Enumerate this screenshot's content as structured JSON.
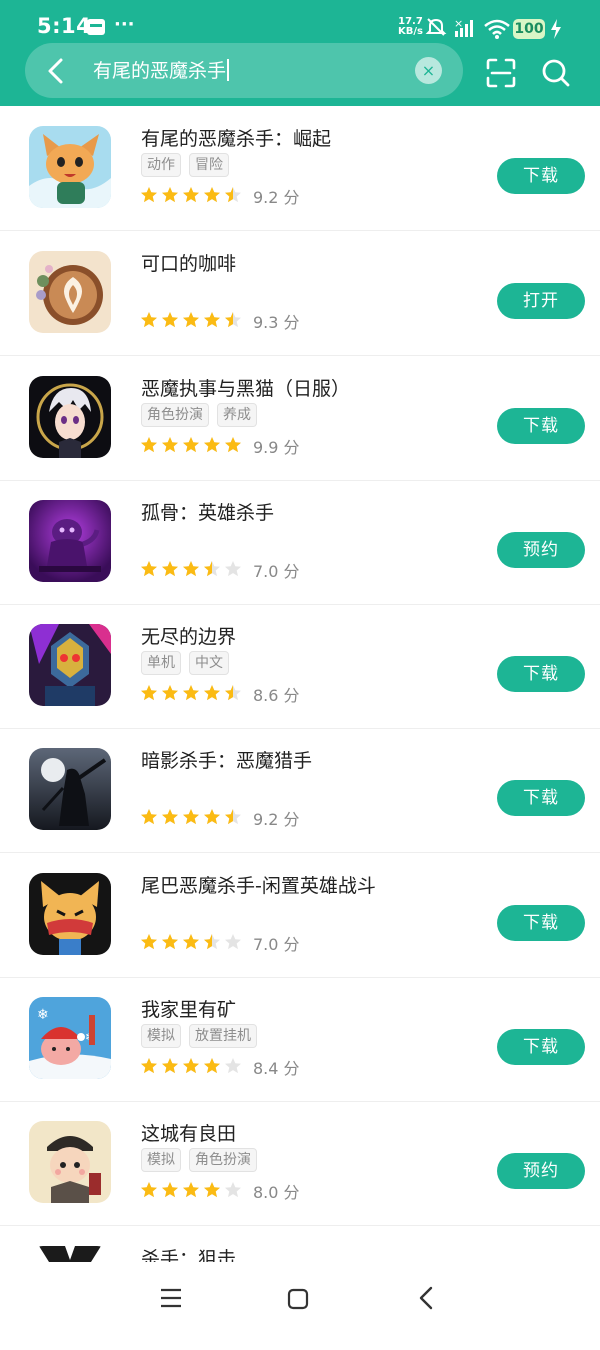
{
  "status_bar": {
    "time": "5:14",
    "more": "···",
    "net_speed_value": "17.7",
    "net_speed_unit": "KB/s",
    "battery": "100"
  },
  "search": {
    "query": "有尾的恶魔杀手",
    "clear_label": "×"
  },
  "apps": [
    {
      "name": "有尾的恶魔杀手：崛起",
      "tags": [
        "动作",
        "冒险"
      ],
      "rating_value": 9.2,
      "rating_text": "9.2 分",
      "action": "下载",
      "icon": "fox-character-icon"
    },
    {
      "name": "可口的咖啡",
      "tags": [],
      "rating_value": 9.3,
      "rating_text": "9.3 分",
      "action": "打开",
      "icon": "latte-art-icon"
    },
    {
      "name": "恶魔执事与黑猫（日服）",
      "tags": [
        "角色扮演",
        "养成"
      ],
      "rating_value": 9.9,
      "rating_text": "9.9 分",
      "action": "下载",
      "icon": "anime-butler-icon"
    },
    {
      "name": "孤骨：英雄杀手",
      "tags": [],
      "rating_value": 7.0,
      "rating_text": "7.0 分",
      "action": "预约",
      "icon": "purple-creature-icon"
    },
    {
      "name": "无尽的边界",
      "tags": [
        "单机",
        "中文"
      ],
      "rating_value": 8.6,
      "rating_text": "8.6 分",
      "action": "下载",
      "icon": "robot-warrior-icon"
    },
    {
      "name": "暗影杀手：恶魔猎手",
      "tags": [],
      "rating_value": 9.2,
      "rating_text": "9.2 分",
      "action": "下载",
      "icon": "shadow-warrior-icon"
    },
    {
      "name": "尾巴恶魔杀手-闲置英雄战斗",
      "tags": [],
      "rating_value": 7.0,
      "rating_text": "7.0 分",
      "action": "下载",
      "icon": "masked-cat-icon"
    },
    {
      "name": "我家里有矿",
      "tags": [
        "模拟",
        "放置挂机"
      ],
      "rating_value": 8.4,
      "rating_text": "8.4 分",
      "action": "下载",
      "icon": "christmas-pig-icon"
    },
    {
      "name": " 这城有良田",
      "tags": [
        "模拟",
        "角色扮演"
      ],
      "rating_value": 8.0,
      "rating_text": "8.0 分",
      "action": "预约",
      "icon": "scholar-character-icon"
    },
    {
      "name": "杀手：狙击",
      "tags": [],
      "rating_value": null,
      "rating_text": "",
      "action": "",
      "icon": "suited-agent-icon"
    }
  ],
  "colors": {
    "brand": "#1db595",
    "star_filled": "#fbbb13",
    "star_empty": "#e4e4e4"
  }
}
